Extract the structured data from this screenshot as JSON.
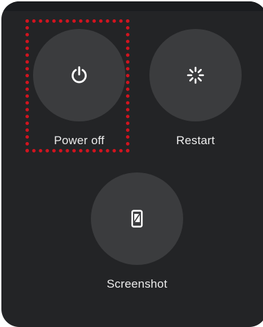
{
  "power_menu": {
    "actions": [
      {
        "id": "power_off",
        "label": "Power off",
        "icon": "power-icon"
      },
      {
        "id": "restart",
        "label": "Restart",
        "icon": "restart-icon"
      },
      {
        "id": "screenshot",
        "label": "Screenshot",
        "icon": "screenshot-icon"
      }
    ],
    "focused_action": "power_off"
  },
  "colors": {
    "panel_background": "#232426",
    "button_background": "#3b3c3e",
    "text": "#ececec",
    "focus_outline": "#d2141f"
  }
}
